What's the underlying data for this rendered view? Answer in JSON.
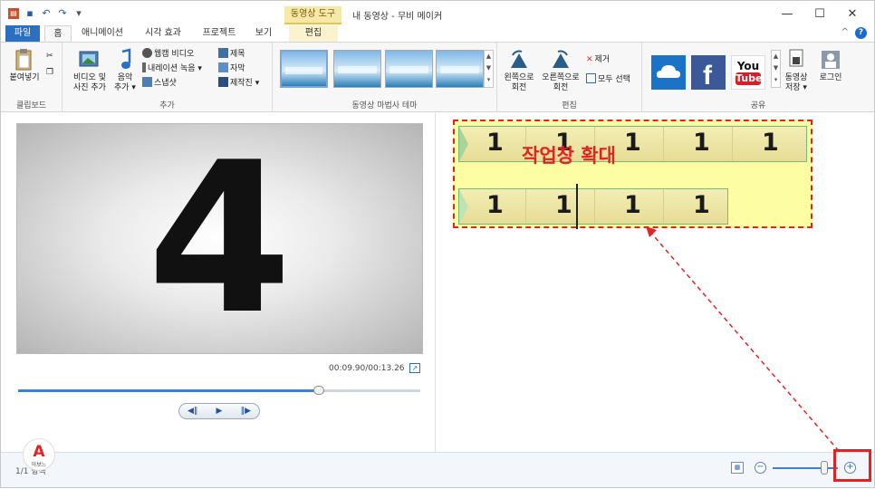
{
  "window": {
    "title": "내 동영상 - 무비 메이커",
    "context_tab": "동영상 도구",
    "controls": [
      "—",
      "☐",
      "✕"
    ]
  },
  "tabs": [
    {
      "label": "파일"
    },
    {
      "label": "홈"
    },
    {
      "label": "애니메이션"
    },
    {
      "label": "시각 효과"
    },
    {
      "label": "프로젝트"
    },
    {
      "label": "보기"
    },
    {
      "label": "편집"
    }
  ],
  "ribbon": {
    "clipboard": {
      "paste": "붙여넣기",
      "group": "클립보드"
    },
    "add": {
      "add_video_line1": "비디오 및",
      "add_video_line2": "사진 추가",
      "add_music_line1": "음악",
      "add_music_line2": "추가 ▾",
      "webcam": "웹캠 비디오",
      "narration": "내레이션 녹음 ▾",
      "snapshot": "스냅샷",
      "title": "제목",
      "caption": "자막",
      "credits": "제작진 ▾",
      "group": "추가"
    },
    "themes": {
      "group": "동영상 마법사 테마",
      "count": 4
    },
    "editing": {
      "rotate_left_line1": "왼쪽으로",
      "rotate_left_line2": "회전",
      "rotate_right_line1": "오른쪽으로",
      "rotate_right_line2": "회전",
      "remove": "제거",
      "select_all": "모두 선택",
      "group": "편집"
    },
    "share": {
      "youtube_line1": "You",
      "youtube_line2": "Tube",
      "save_movie_line1": "동영상",
      "save_movie_line2": "저장 ▾",
      "signin": "로그인",
      "group": "공유"
    }
  },
  "preview": {
    "frame_digit": "4",
    "timecode": "00:09.90/00:13.26",
    "progress": 0.747
  },
  "storyboard": {
    "row1_digits": [
      "1",
      "1",
      "1",
      "1",
      "1"
    ],
    "row2_digits": [
      "1",
      "1",
      "1",
      "1"
    ],
    "annotation": "작업창 확대"
  },
  "status": {
    "items": "1/1 항목",
    "logo_text": "아보느",
    "zoom_level": 0.72
  },
  "colors": {
    "file_tab": "#2b6fc1",
    "annotation": "#e02424",
    "highlight_fill": "#fdfda3",
    "strip_border": "#79b877"
  }
}
